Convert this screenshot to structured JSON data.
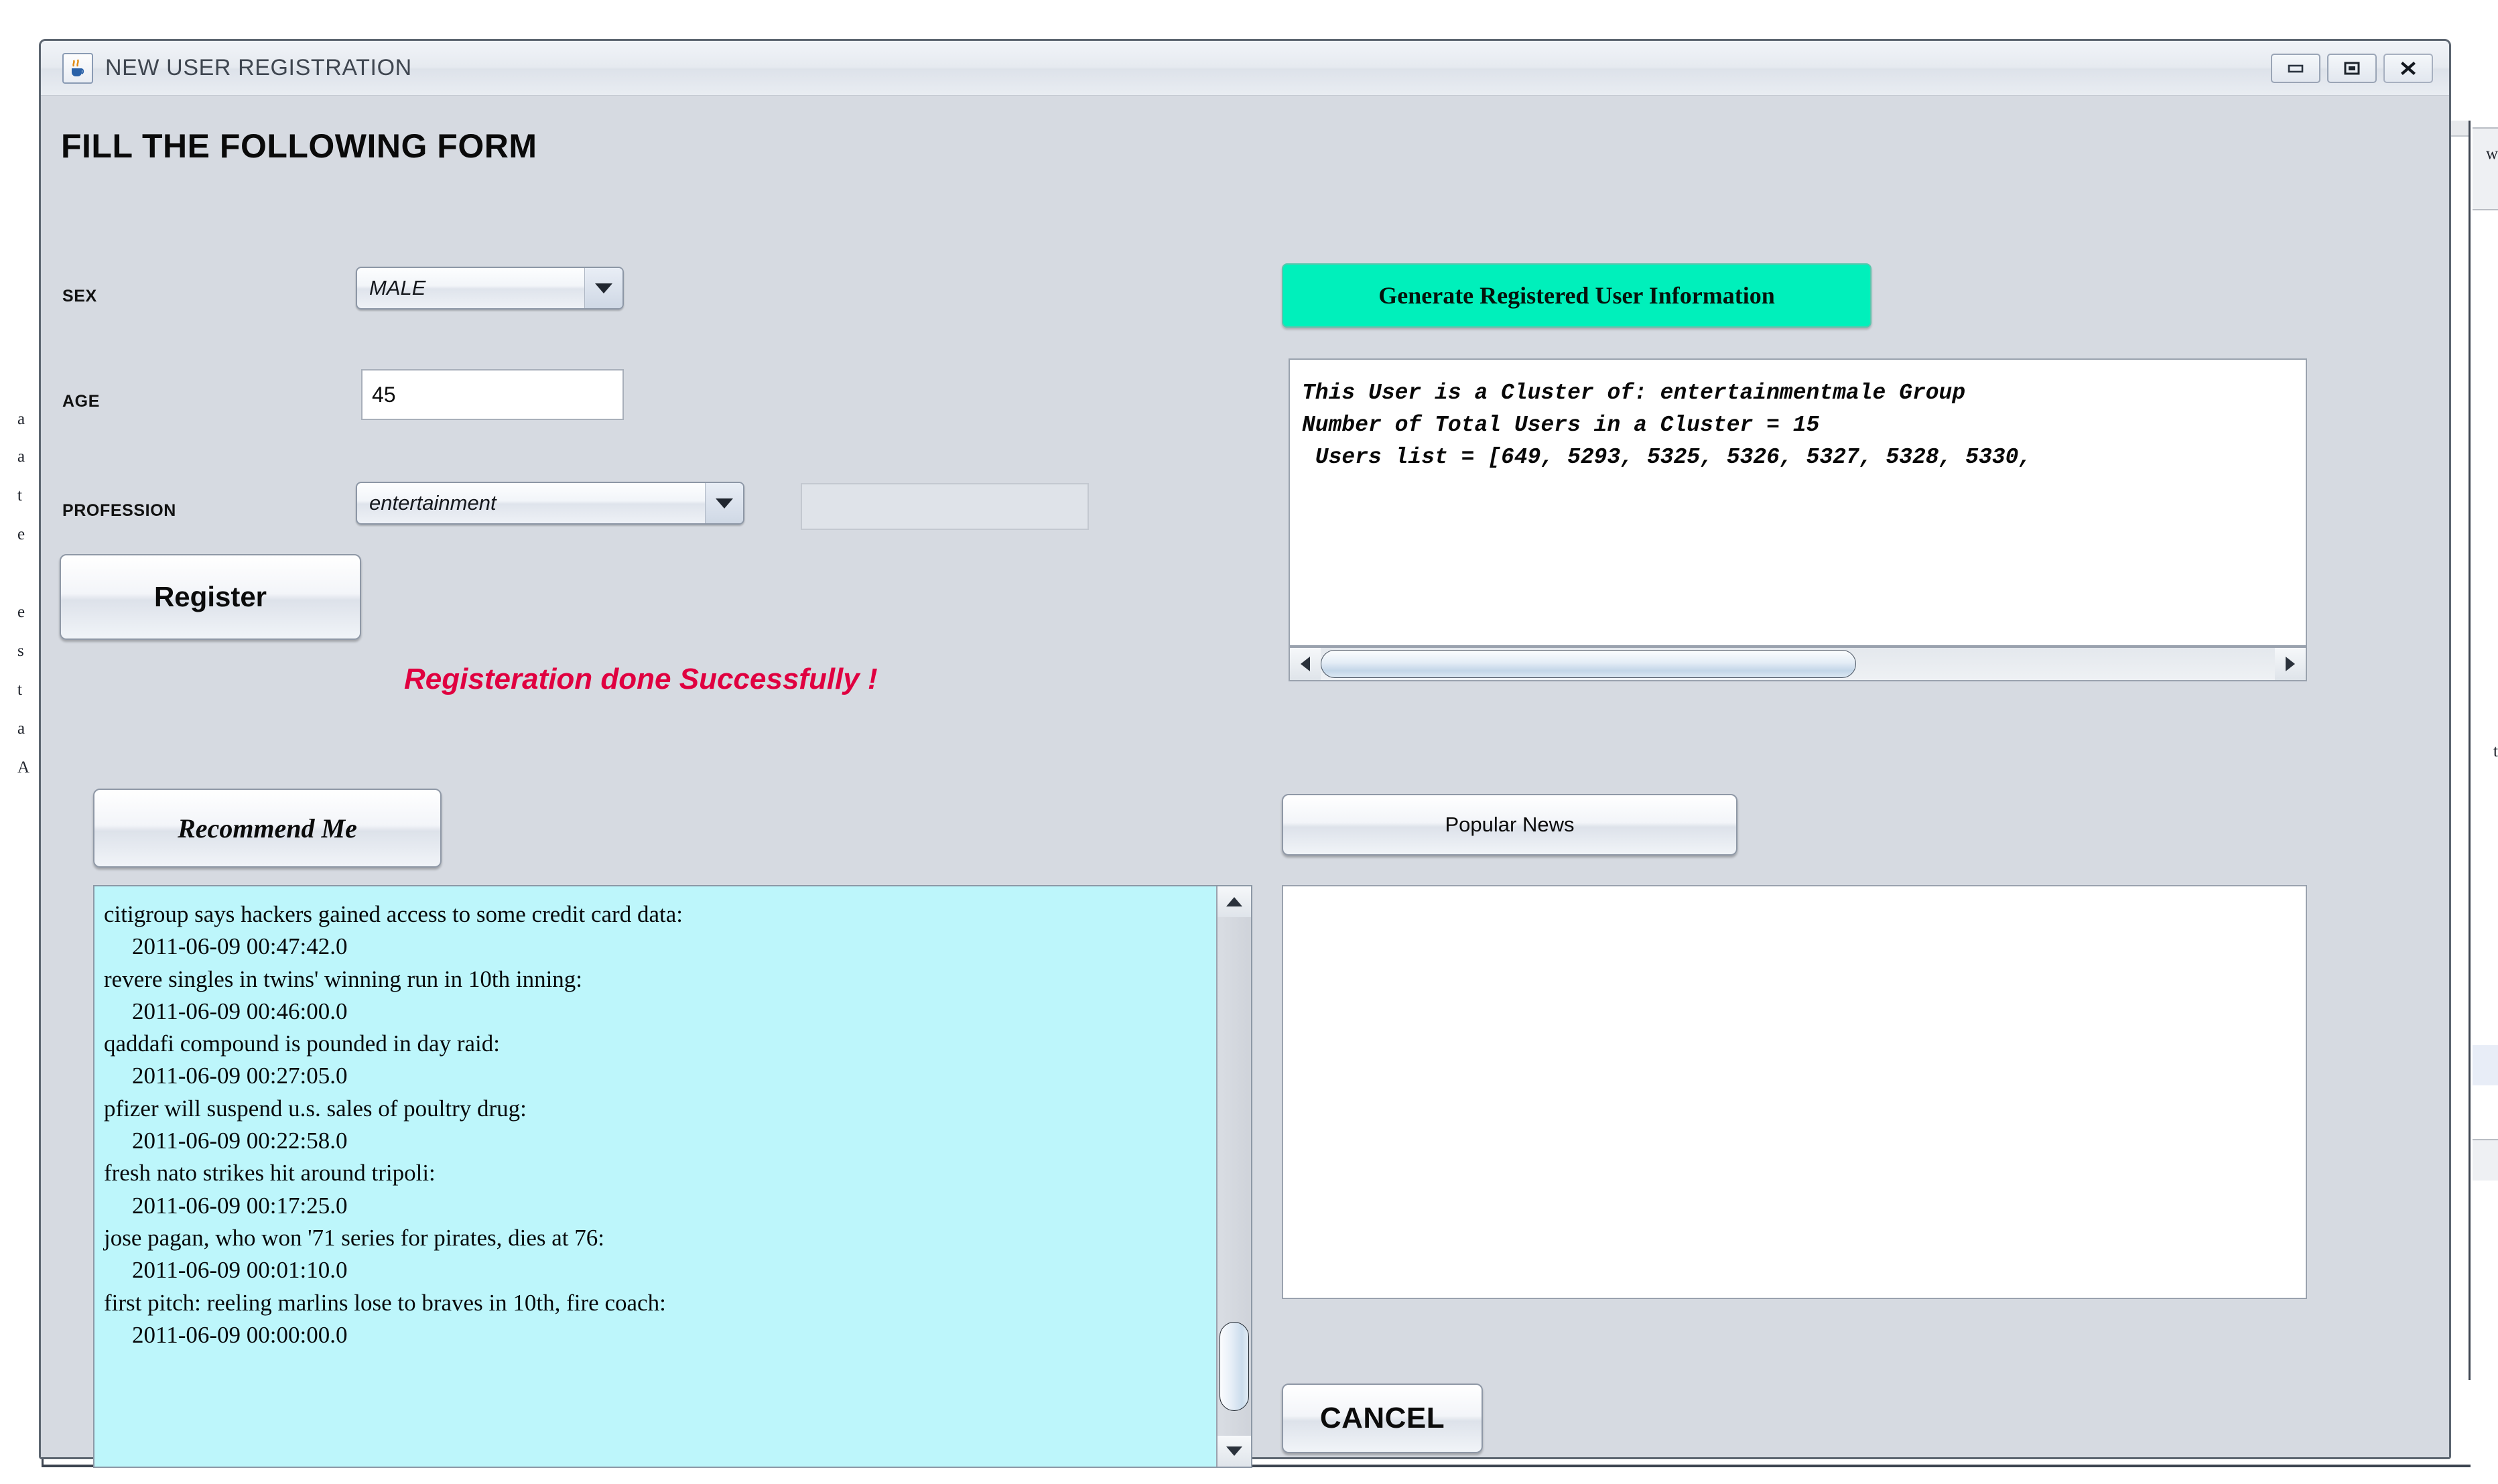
{
  "window": {
    "title": "NEW USER REGISTRATION",
    "icon": "java-coffee-cup-icon",
    "controls": {
      "minimize": "minimize-icon",
      "maximize": "maximize-icon",
      "close": "close-icon"
    }
  },
  "form": {
    "headline": "FILL THE FOLLOWING FORM",
    "fields": [
      {
        "label": "SEX",
        "value": "MALE",
        "type": "combobox"
      },
      {
        "label": "AGE",
        "value": "45",
        "type": "textfield"
      },
      {
        "label": "PROFESSION",
        "value": "entertainment",
        "type": "combobox"
      }
    ],
    "extra_field_value": "",
    "register_label": "Register",
    "status_message": "Registeration done Successfully !",
    "status_color": "#e00040"
  },
  "right_panel": {
    "generate_button_label": "Generate Registered User Information",
    "generate_button_color": "#00f0bb",
    "cluster_info_lines": [
      "This User is a Cluster of: entertainmentmale Group",
      "Number of Total Users in a Cluster = 15",
      " Users list = [649, 5293, 5325, 5326, 5327, 5328, 5330,"
    ],
    "popular_news_label": "Popular News",
    "popular_news_content": "",
    "cancel_label": "CANCEL"
  },
  "recommend": {
    "button_label": "Recommend Me",
    "list_background": "#bdf6fb",
    "items": [
      {
        "title": "citigroup says hackers gained access to some credit card data:",
        "time": "2011-06-09 00:47:42.0"
      },
      {
        "title": "revere singles in twins' winning run in 10th inning:",
        "time": "2011-06-09 00:46:00.0"
      },
      {
        "title": "qaddafi compound is pounded in day raid:",
        "time": "2011-06-09 00:27:05.0"
      },
      {
        "title": "pfizer will suspend u.s. sales of poultry drug:",
        "time": "2011-06-09 00:22:58.0"
      },
      {
        "title": "fresh nato strikes hit around tripoli:",
        "time": "2011-06-09 00:17:25.0"
      },
      {
        "title": "jose pagan, who won '71 series for pirates, dies at 76:",
        "time": "2011-06-09 00:01:10.0"
      },
      {
        "title": "first pitch: reeling marlins lose to braves in 10th, fire coach:",
        "time": "2011-06-09 00:00:00.0"
      }
    ]
  },
  "scrollbars": {
    "cluster_horizontal": {
      "left_arrow": "left-arrow-icon",
      "right_arrow": "right-arrow-icon"
    },
    "news_vertical": {
      "up_arrow": "up-arrow-icon",
      "down_arrow": "down-arrow-icon"
    }
  },
  "background": {
    "left_fragments": [
      "a",
      "a",
      "t",
      "e",
      "e",
      "s",
      "t",
      "a",
      "A"
    ],
    "right_fragments": [
      "w",
      "t"
    ]
  }
}
